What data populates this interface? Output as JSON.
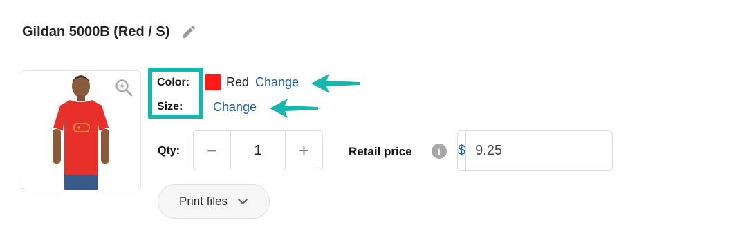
{
  "product": {
    "title": "Gildan 5000B (Red / S)"
  },
  "attributes": {
    "color_label": "Color:",
    "color_value": "Red",
    "color_swatch": "#ff1a1a",
    "size_label": "Size:",
    "change_label": "Change"
  },
  "quantity": {
    "label": "Qty:",
    "value": "1",
    "minus": "−",
    "plus": "+"
  },
  "retail": {
    "label": "Retail price",
    "currency": "$",
    "value": "9.25",
    "info_icon": "info-icon"
  },
  "print_files": {
    "label": "Print files"
  },
  "colors": {
    "accent_link": "#1a5fa6",
    "highlight": "#16b5ad"
  }
}
